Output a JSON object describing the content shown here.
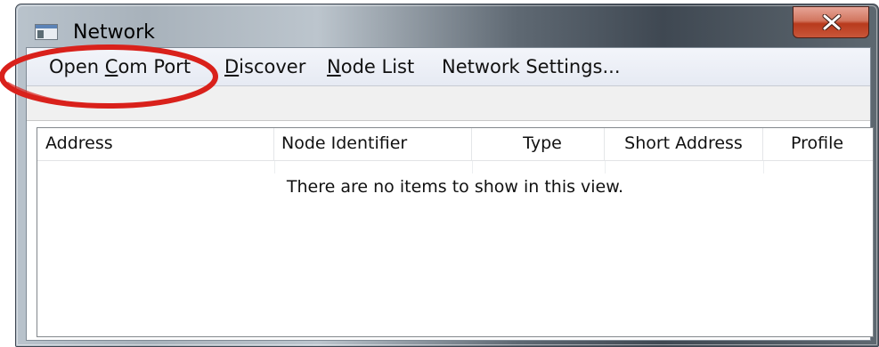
{
  "window": {
    "title": "Network",
    "close_glyph": "x",
    "icon": "application-window-icon",
    "close_icon": "close-icon"
  },
  "menu": {
    "items": [
      {
        "underline": "",
        "pre": "Open ",
        "key": "C",
        "post": "om Port"
      },
      {
        "pre": "",
        "key": "D",
        "post": "iscover"
      },
      {
        "pre": "",
        "key": "N",
        "post": "ode List"
      },
      {
        "pre": "Network Settings...",
        "key": "",
        "post": ""
      }
    ]
  },
  "list": {
    "columns": [
      "Address",
      "Node Identifier",
      "Type",
      "Short Address",
      "Profile"
    ],
    "empty_message": "There are no items to show in this view."
  },
  "annotation": {
    "shape": "red ellipse highlighting Open Com Port",
    "color": "#d9211b"
  }
}
